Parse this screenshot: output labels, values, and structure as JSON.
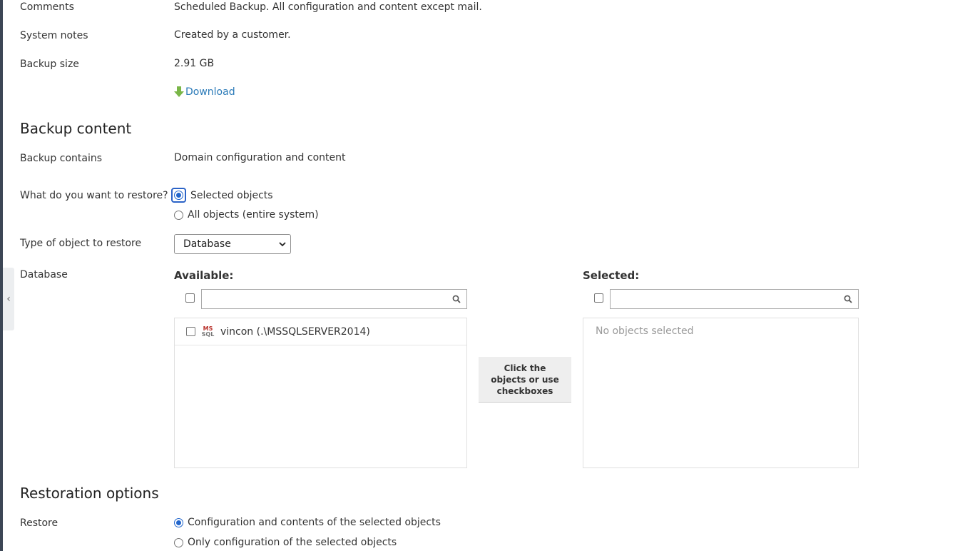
{
  "details": {
    "comments_label": "Comments",
    "comments_value": "Scheduled Backup. All configuration and content except mail.",
    "system_notes_label": "System notes",
    "system_notes_value": "Created by a customer.",
    "backup_size_label": "Backup size",
    "backup_size_value": "2.91 GB",
    "download_label": "Download"
  },
  "backup_content": {
    "heading": "Backup content",
    "contains_label": "Backup contains",
    "contains_value": "Domain configuration and content",
    "restore_question": "What do you want to restore?",
    "restore_options": [
      {
        "label": "Selected objects",
        "selected": true
      },
      {
        "label": "All objects (entire system)",
        "selected": false
      }
    ],
    "type_label": "Type of object to restore",
    "type_value": "Database",
    "database_label": "Database",
    "available_title": "Available:",
    "selected_title": "Selected:",
    "available_items": [
      {
        "label": "vincon (.\\MSSQLSERVER2014)",
        "icon": "mssql-icon",
        "checked": false
      }
    ],
    "selected_empty_text": "No objects selected",
    "transfer_hint": "Click the objects or use checkboxes"
  },
  "restoration": {
    "heading": "Restoration options",
    "restore_label": "Restore",
    "options": [
      {
        "label": "Configuration and contents of the selected objects",
        "selected": true
      },
      {
        "label": "Only configuration of the selected objects",
        "selected": false
      }
    ]
  },
  "colors": {
    "accent": "#2266cc",
    "link": "#2a7ab8",
    "download_icon": "#7ab648",
    "sidebar": "#3c4655"
  }
}
